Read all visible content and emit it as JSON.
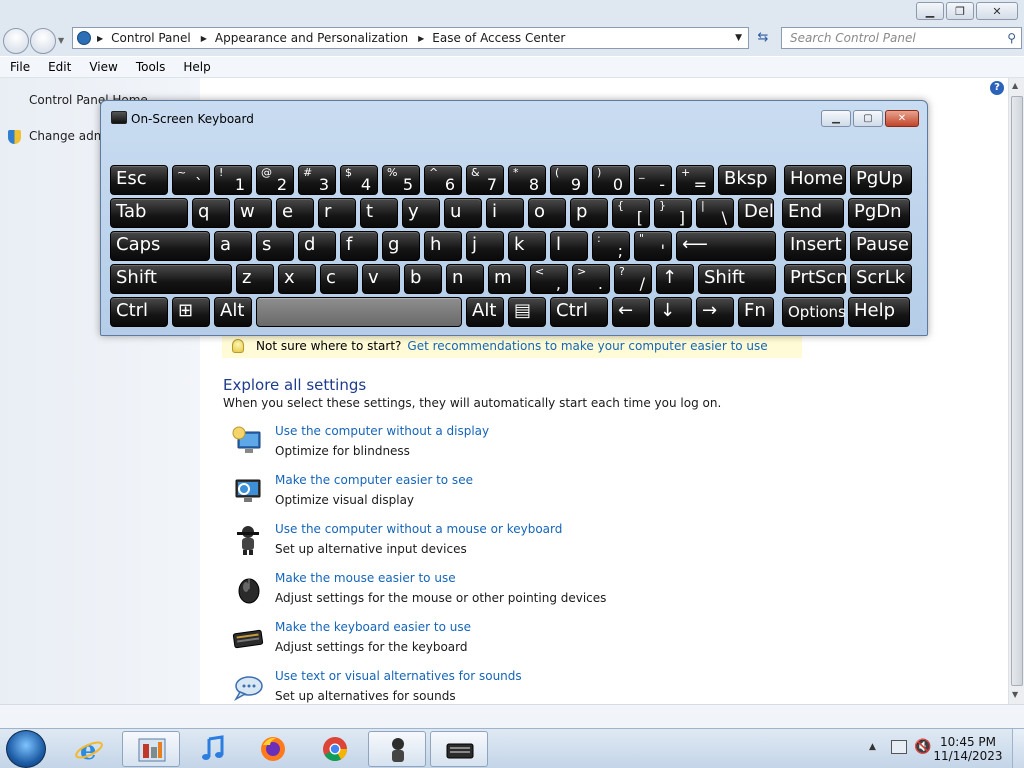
{
  "window": {
    "search_placeholder": "Search Control Panel",
    "breadcrumb": [
      "Control Panel",
      "Appearance and Personalization",
      "Ease of Access Center"
    ]
  },
  "menu": [
    "File",
    "Edit",
    "View",
    "Tools",
    "Help"
  ],
  "left_pane": {
    "home_link": "Control Panel Home",
    "admin_link": "Change admi"
  },
  "tip": {
    "text": "Not sure where to start?",
    "link": "Get recommendations to make your computer easier to use"
  },
  "explore": {
    "title": "Explore all settings",
    "description": "When you select these settings, they will automatically start each time you log on.",
    "items": [
      {
        "link": "Use the computer without a display",
        "desc": "Optimize for blindness"
      },
      {
        "link": "Make the computer easier to see",
        "desc": "Optimize visual display"
      },
      {
        "link": "Use the computer without a mouse or keyboard",
        "desc": "Set up alternative input devices"
      },
      {
        "link": "Make the mouse easier to use",
        "desc": "Adjust settings for the mouse or other pointing devices"
      },
      {
        "link": "Make the keyboard easier to use",
        "desc": "Adjust settings for the keyboard"
      },
      {
        "link": "Use text or visual alternatives for sounds",
        "desc": "Set up alternatives for sounds"
      }
    ]
  },
  "osk": {
    "title": "On-Screen Keyboard",
    "rows": [
      [
        {
          "l": "Esc"
        },
        {
          "up": "~",
          "dn": "`"
        },
        {
          "up": "!",
          "dn": "1"
        },
        {
          "up": "@",
          "dn": "2"
        },
        {
          "up": "#",
          "dn": "3"
        },
        {
          "up": "$",
          "dn": "4"
        },
        {
          "up": "%",
          "dn": "5"
        },
        {
          "up": "^",
          "dn": "6"
        },
        {
          "up": "&",
          "dn": "7"
        },
        {
          "up": "*",
          "dn": "8"
        },
        {
          "up": "(",
          "dn": "9"
        },
        {
          "up": ")",
          "dn": "0"
        },
        {
          "up": "_",
          "dn": "-"
        },
        {
          "up": "+",
          "dn": "="
        },
        {
          "l": "Bksp"
        },
        {
          "l": "Home"
        },
        {
          "l": "PgUp"
        }
      ],
      [
        {
          "l": "Tab"
        },
        {
          "l": "q"
        },
        {
          "l": "w"
        },
        {
          "l": "e"
        },
        {
          "l": "r"
        },
        {
          "l": "t"
        },
        {
          "l": "y"
        },
        {
          "l": "u"
        },
        {
          "l": "i"
        },
        {
          "l": "o"
        },
        {
          "l": "p"
        },
        {
          "up": "{",
          "dn": "["
        },
        {
          "up": "}",
          "dn": "]"
        },
        {
          "up": "|",
          "dn": "\\"
        },
        {
          "l": "Del"
        },
        {
          "l": "End"
        },
        {
          "l": "PgDn"
        }
      ],
      [
        {
          "l": "Caps"
        },
        {
          "l": "a"
        },
        {
          "l": "s"
        },
        {
          "l": "d"
        },
        {
          "l": "f"
        },
        {
          "l": "g"
        },
        {
          "l": "h"
        },
        {
          "l": "j"
        },
        {
          "l": "k"
        },
        {
          "l": "l"
        },
        {
          "up": ":",
          "dn": ";"
        },
        {
          "up": "\"",
          "dn": "'"
        },
        {
          "l": "⟵"
        },
        {
          "l": "Insert"
        },
        {
          "l": "Pause"
        }
      ],
      [
        {
          "l": "Shift"
        },
        {
          "l": "z"
        },
        {
          "l": "x"
        },
        {
          "l": "c"
        },
        {
          "l": "v"
        },
        {
          "l": "b"
        },
        {
          "l": "n"
        },
        {
          "l": "m"
        },
        {
          "up": "<",
          "dn": ","
        },
        {
          "up": ">",
          "dn": "."
        },
        {
          "up": "?",
          "dn": "/"
        },
        {
          "l": "↑"
        },
        {
          "l": "Shift"
        },
        {
          "l": "PrtScn"
        },
        {
          "l": "ScrLk"
        }
      ],
      [
        {
          "l": "Ctrl"
        },
        {
          "l": "⊞"
        },
        {
          "l": "Alt"
        },
        {
          "l": ""
        },
        {
          "l": "Alt"
        },
        {
          "l": "▤"
        },
        {
          "l": "Ctrl"
        },
        {
          "l": "←"
        },
        {
          "l": "↓"
        },
        {
          "l": "→"
        },
        {
          "l": "Fn"
        },
        {
          "l": "Options"
        },
        {
          "l": "Help"
        }
      ]
    ]
  },
  "taskbar": {
    "time": "10:45 PM",
    "date": "11/14/2023"
  }
}
